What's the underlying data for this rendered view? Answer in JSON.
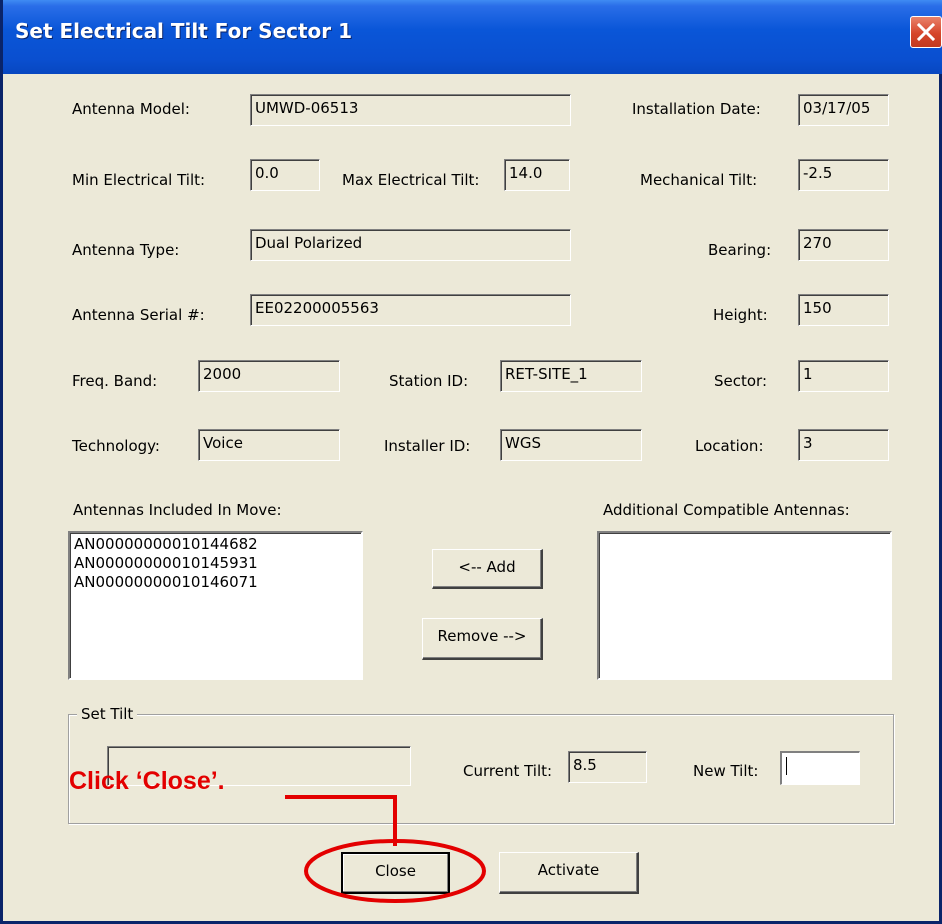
{
  "window": {
    "title": "Set Electrical Tilt For Sector 1"
  },
  "fields": {
    "antenna_model": {
      "label": "Antenna Model:",
      "value": "UMWD-06513"
    },
    "installation_date": {
      "label": "Installation Date:",
      "value": "03/17/05"
    },
    "min_electrical_tilt": {
      "label": "Min Electrical Tilt:",
      "value": "0.0"
    },
    "max_electrical_tilt": {
      "label": "Max Electrical Tilt:",
      "value": "14.0"
    },
    "mechanical_tilt": {
      "label": "Mechanical Tilt:",
      "value": "-2.5"
    },
    "antenna_type": {
      "label": "Antenna Type:",
      "value": "Dual Polarized"
    },
    "bearing": {
      "label": "Bearing:",
      "value": "270"
    },
    "antenna_serial": {
      "label": "Antenna Serial #:",
      "value": "EE02200005563"
    },
    "height": {
      "label": "Height:",
      "value": "150"
    },
    "freq_band": {
      "label": "Freq. Band:",
      "value": "2000"
    },
    "station_id": {
      "label": "Station ID:",
      "value": "RET-SITE_1"
    },
    "sector": {
      "label": "Sector:",
      "value": "1"
    },
    "technology": {
      "label": "Technology:",
      "value": "Voice"
    },
    "installer_id": {
      "label": "Installer ID:",
      "value": "WGS"
    },
    "location": {
      "label": "Location:",
      "value": "3"
    }
  },
  "antennas_included": {
    "label": "Antennas Included In Move:",
    "items": [
      "AN00000000010144682",
      "AN00000000010145931",
      "AN00000000010146071"
    ]
  },
  "additional_compatible": {
    "label": "Additional Compatible Antennas:",
    "items": []
  },
  "buttons": {
    "add": "<-- Add",
    "remove": "Remove -->",
    "close": "Close",
    "activate": "Activate"
  },
  "set_tilt": {
    "group_label": "Set Tilt",
    "status_value": "",
    "current_tilt_label": "Current Tilt:",
    "current_tilt_value": "8.5",
    "new_tilt_label": "New Tilt:",
    "new_tilt_value": ""
  },
  "annotation": {
    "text": "Click ‘Close’.",
    "color": "#e30000"
  }
}
